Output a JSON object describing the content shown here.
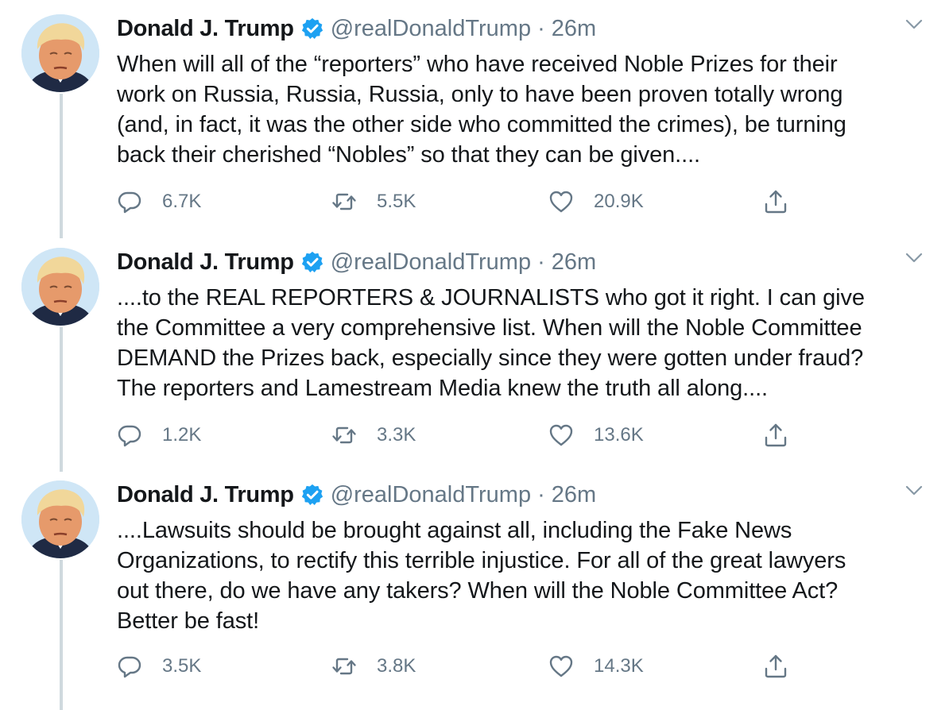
{
  "tweets": [
    {
      "author_name": "Donald J. Trump",
      "handle": "@realDonaldTrump",
      "separator": "·",
      "time": "26m",
      "text": "When will all of the “reporters” who have received Noble Prizes for their\nwork on Russia, Russia, Russia, only to have been proven totally wrong\n(and, in fact, it was the other side who committed the crimes), be turning\nback their cherished “Nobles” so that they can be given....",
      "replies": "6.7K",
      "retweets": "5.5K",
      "likes": "20.9K"
    },
    {
      "author_name": "Donald J. Trump",
      "handle": "@realDonaldTrump",
      "separator": "·",
      "time": "26m",
      "text": "....to the REAL REPORTERS & JOURNALISTS who got it right. I can give\nthe Committee a very comprehensive list. When will the Noble Committee\nDEMAND the Prizes back, especially since they were gotten under fraud?\nThe reporters and Lamestream Media knew the truth all along....",
      "replies": "1.2K",
      "retweets": "3.3K",
      "likes": "13.6K"
    },
    {
      "author_name": "Donald J. Trump",
      "handle": "@realDonaldTrump",
      "separator": "·",
      "time": "26m",
      "text": "....Lawsuits should be brought against all, including the Fake News\nOrganizations, to rectify this terrible injustice. For all of the great lawyers\nout there, do we have any takers? When will the Noble Committee Act?\nBetter be fast!",
      "replies": "3.5K",
      "retweets": "3.8K",
      "likes": "14.3K"
    }
  ],
  "icons": {
    "reply": "reply-icon",
    "retweet": "retweet-icon",
    "like": "heart-icon",
    "share": "share-icon",
    "verified": "verified-badge-icon",
    "caret": "chevron-down-icon"
  },
  "colors": {
    "verified_blue": "#1da1f2",
    "secondary_text": "#657786",
    "thread_line": "#cfd9de"
  }
}
